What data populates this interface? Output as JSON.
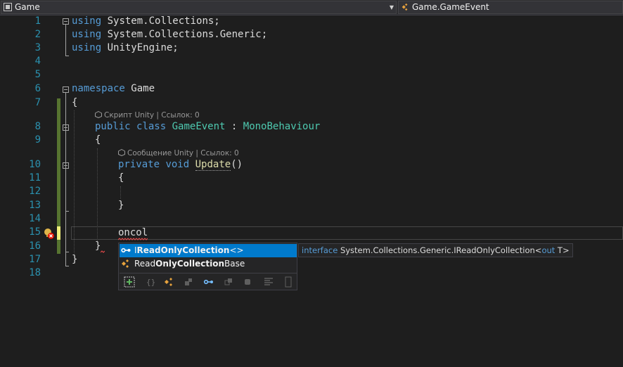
{
  "nav": {
    "left_label": "Game",
    "right_label": "Game.GameEvent"
  },
  "line_numbers": [
    "1",
    "2",
    "3",
    "4",
    "5",
    "6",
    "7",
    "8",
    "9",
    "10",
    "11",
    "12",
    "13",
    "14",
    "15",
    "16",
    "17",
    "18"
  ],
  "code": {
    "l1_kw": "using",
    "l1_rest": " System.Collections;",
    "l2_kw": "using",
    "l2_rest": " System.Collections.Generic;",
    "l3_kw": "using",
    "l3_rest": " UnityEngine;",
    "l6_kw": "namespace",
    "l6_rest": " Game",
    "l7": "{",
    "l8_kw1": "public",
    "l8_kw2": "class",
    "l8_class": "GameEvent",
    "l8_colon": " : ",
    "l8_base": "MonoBehaviour",
    "l9": "{",
    "l10_kw1": "private",
    "l10_kw2": "void",
    "l10_fn": "Update",
    "l10_paren": "()",
    "l11": "{",
    "l13": "}",
    "l15": "oncol",
    "l16": "}",
    "l17": "}"
  },
  "codelens": {
    "class_lens": "Скрипт Unity | Ссылок: 0",
    "method_lens": "Сообщение Unity | Ссылок: 0"
  },
  "completion": {
    "items": [
      {
        "pre": "I",
        "b1": "ReadOnlyCollection",
        "post": "<>",
        "icon": "interface-icon",
        "selected": true
      },
      {
        "pre": "Read",
        "b1": "OnlyCollection",
        "post": "Base",
        "icon": "class-icon",
        "selected": false
      }
    ],
    "filters": [
      "snippet-filter",
      "namespace-filter",
      "class-filter",
      "struct-filter",
      "interface-filter",
      "enum-filter",
      "delegate-filter",
      "module-filter",
      "type-parameter-filter"
    ]
  },
  "tooltip": {
    "kw": "interface",
    "name": " System.Collections.Generic.IReadOnlyCollection",
    "lt": "<",
    "out": "out",
    "rest": " T>"
  },
  "colors": {
    "background": "#1e1e1e",
    "keyword": "#569cd6",
    "type": "#4ec9b0",
    "method": "#dcdcaa",
    "line_number": "#2b91af",
    "selection": "#007acc",
    "change_marker": "#577430"
  }
}
